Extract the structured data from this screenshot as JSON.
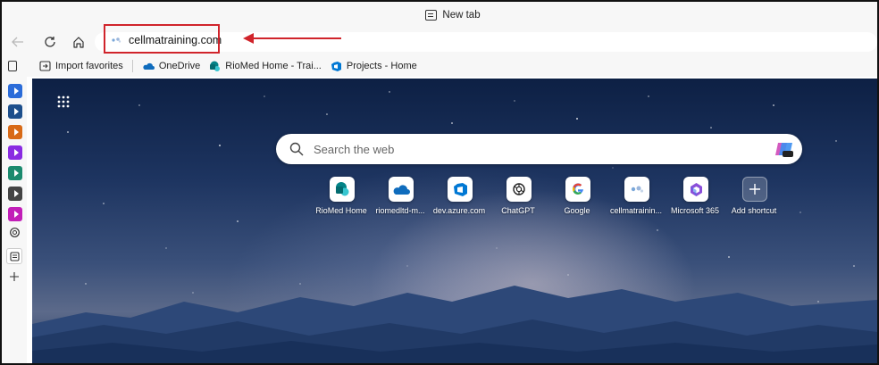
{
  "window": {
    "tab_title": "New tab"
  },
  "address_bar": {
    "url": "cellmatraining.com"
  },
  "favorites": [
    {
      "label": "Import favorites",
      "icon": "import-icon"
    },
    {
      "label": "OneDrive",
      "icon": "onedrive-icon"
    },
    {
      "label": "RioMed Home - Trai...",
      "icon": "sharepoint-icon"
    },
    {
      "label": "Projects - Home",
      "icon": "azure-devops-icon"
    }
  ],
  "search": {
    "placeholder": "Search the web"
  },
  "shortcuts": [
    {
      "label": "RioMed Home",
      "icon": "sharepoint-icon"
    },
    {
      "label": "riomedltd-m...",
      "icon": "onedrive-icon"
    },
    {
      "label": "dev.azure.com",
      "icon": "azure-devops-icon"
    },
    {
      "label": "ChatGPT",
      "icon": "chatgpt-icon"
    },
    {
      "label": "Google",
      "icon": "google-icon"
    },
    {
      "label": "cellmatrainin...",
      "icon": "cellma-icon"
    },
    {
      "label": "Microsoft 365",
      "icon": "microsoft365-icon"
    },
    {
      "label": "Add shortcut",
      "icon": "plus-icon"
    }
  ],
  "colors": {
    "annotation_red": "#d0242b",
    "accent_blue": "#0f6cbd"
  }
}
